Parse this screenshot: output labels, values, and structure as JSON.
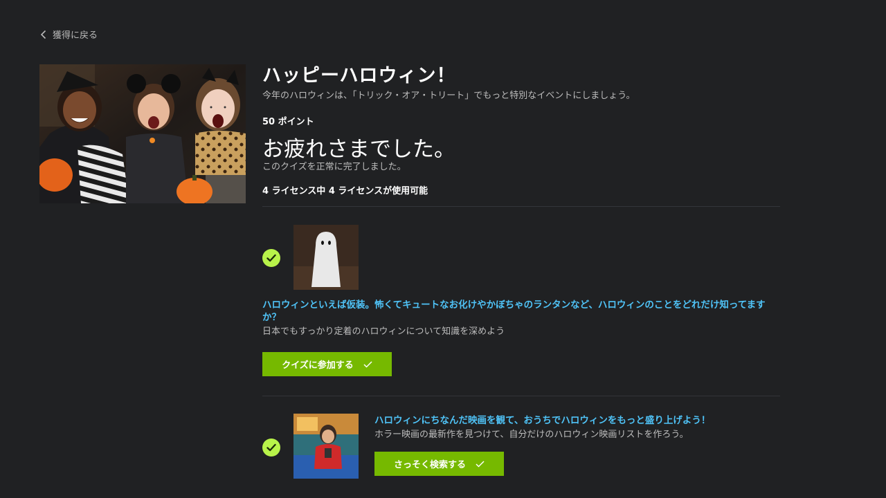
{
  "nav": {
    "back_label": "獲得に戻る"
  },
  "event": {
    "title": "ハッピーハロウィン！",
    "subtitle": "今年のハロウィンは、「トリック・オア・トリート」でもっと特別なイベントにしましょう。",
    "points": "50 ポイント",
    "completion_title": "お疲れさまでした。",
    "completion_subtitle": "このクイズを正常に完了しました。",
    "license_status": "4 ライセンス中 4 ライセンスが使用可能"
  },
  "tasks": [
    {
      "title": "ハロウィンといえば仮装。怖くてキュートなお化けやかぼちゃのランタンなど、ハロウィンのことをどれだけ知ってますか？",
      "description": "日本でもすっかり定着のハロウィンについて知識を深めよう",
      "button_label": "クイズに参加する",
      "completed": true,
      "icon": "ghost-thumbnail"
    },
    {
      "title": "ハロウィンにちなんだ映画を観て、おうちでハロウィンをもっと盛り上げよう！",
      "description": "ホラー映画の最新作を見つけて、自分だけのハロウィン映画リストを作ろう。",
      "button_label": "さっそく検索する",
      "completed": true,
      "icon": "movie-viewer-thumbnail"
    }
  ],
  "colors": {
    "background": "#202123",
    "accent_green": "#76b900",
    "check_green": "#b8f34a",
    "link_blue": "#4fc3f7"
  }
}
